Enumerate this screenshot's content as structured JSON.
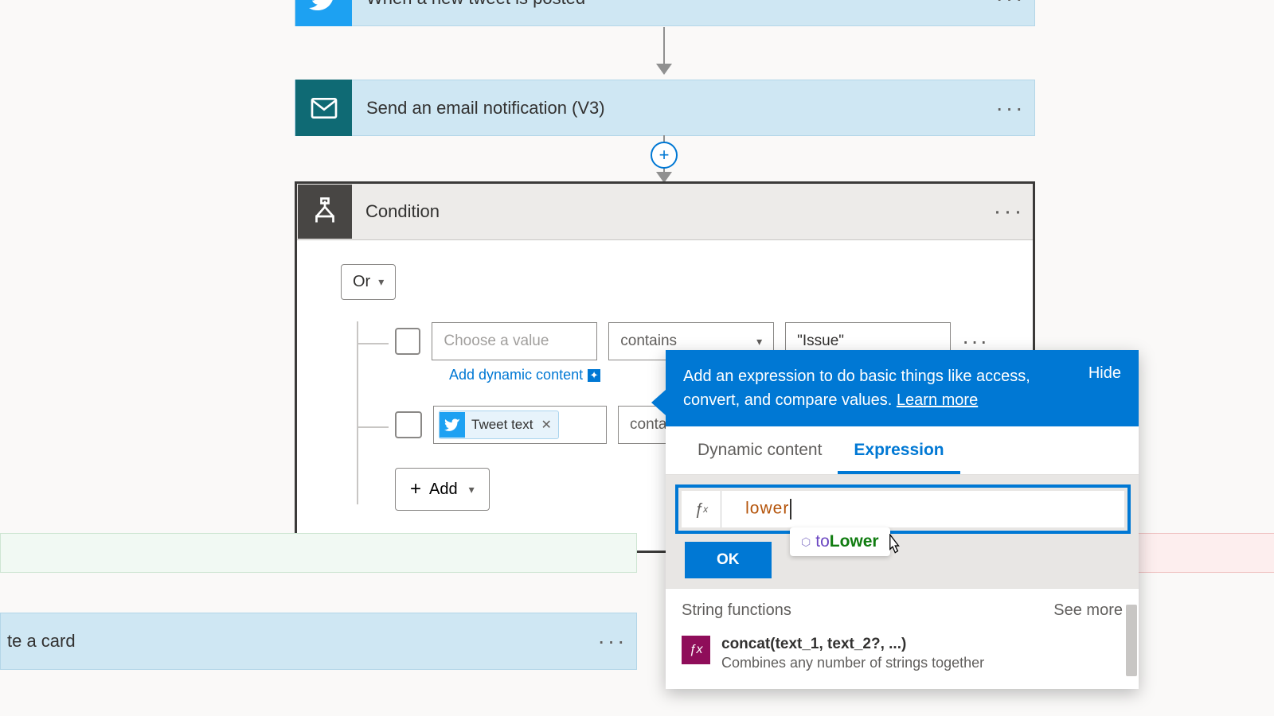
{
  "steps": {
    "twitter": {
      "title": "When a new tweet is posted"
    },
    "email": {
      "title": "Send an email notification (V3)"
    }
  },
  "condition": {
    "title": "Condition",
    "logic": "Or",
    "row1": {
      "value_placeholder": "Choose a value",
      "operator": "contains",
      "value2": "\"Issue\""
    },
    "add_dynamic": "Add dynamic content",
    "row2": {
      "token": "Tweet text",
      "operator_partial": "conta"
    },
    "add_button": "Add"
  },
  "left_card": {
    "title": "te a card"
  },
  "popup": {
    "description": "Add an expression to do basic things like access, convert, and compare values.",
    "learn_more": "Learn more",
    "hide": "Hide",
    "tabs": {
      "dynamic": "Dynamic content",
      "expression": "Expression"
    },
    "expr_input": "lower",
    "suggestion_prefix": "to",
    "suggestion_match": "Lower",
    "ok": "OK",
    "section_title": "String functions",
    "see_more": "See more",
    "fn": {
      "name": "concat(text_1, text_2?, ...)",
      "desc": "Combines any number of strings together"
    }
  }
}
